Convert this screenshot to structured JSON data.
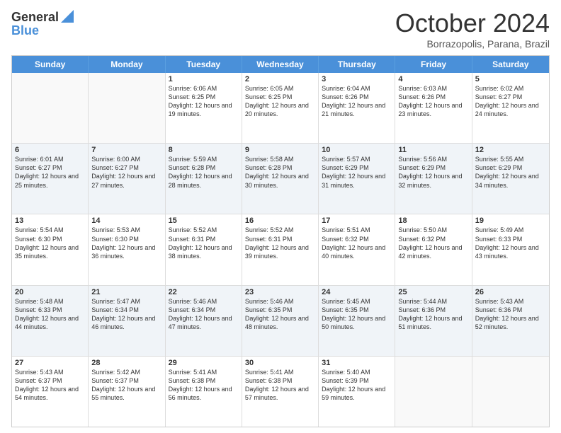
{
  "logo": {
    "line1": "General",
    "line2": "Blue"
  },
  "title": "October 2024",
  "subtitle": "Borrazopolis, Parana, Brazil",
  "days": [
    "Sunday",
    "Monday",
    "Tuesday",
    "Wednesday",
    "Thursday",
    "Friday",
    "Saturday"
  ],
  "rows": [
    [
      {
        "day": "",
        "text": "",
        "empty": true
      },
      {
        "day": "",
        "text": "",
        "empty": true
      },
      {
        "day": "1",
        "text": "Sunrise: 6:06 AM\nSunset: 6:25 PM\nDaylight: 12 hours and 19 minutes."
      },
      {
        "day": "2",
        "text": "Sunrise: 6:05 AM\nSunset: 6:25 PM\nDaylight: 12 hours and 20 minutes."
      },
      {
        "day": "3",
        "text": "Sunrise: 6:04 AM\nSunset: 6:26 PM\nDaylight: 12 hours and 21 minutes."
      },
      {
        "day": "4",
        "text": "Sunrise: 6:03 AM\nSunset: 6:26 PM\nDaylight: 12 hours and 23 minutes."
      },
      {
        "day": "5",
        "text": "Sunrise: 6:02 AM\nSunset: 6:27 PM\nDaylight: 12 hours and 24 minutes."
      }
    ],
    [
      {
        "day": "6",
        "text": "Sunrise: 6:01 AM\nSunset: 6:27 PM\nDaylight: 12 hours and 25 minutes."
      },
      {
        "day": "7",
        "text": "Sunrise: 6:00 AM\nSunset: 6:27 PM\nDaylight: 12 hours and 27 minutes."
      },
      {
        "day": "8",
        "text": "Sunrise: 5:59 AM\nSunset: 6:28 PM\nDaylight: 12 hours and 28 minutes."
      },
      {
        "day": "9",
        "text": "Sunrise: 5:58 AM\nSunset: 6:28 PM\nDaylight: 12 hours and 30 minutes."
      },
      {
        "day": "10",
        "text": "Sunrise: 5:57 AM\nSunset: 6:29 PM\nDaylight: 12 hours and 31 minutes."
      },
      {
        "day": "11",
        "text": "Sunrise: 5:56 AM\nSunset: 6:29 PM\nDaylight: 12 hours and 32 minutes."
      },
      {
        "day": "12",
        "text": "Sunrise: 5:55 AM\nSunset: 6:29 PM\nDaylight: 12 hours and 34 minutes."
      }
    ],
    [
      {
        "day": "13",
        "text": "Sunrise: 5:54 AM\nSunset: 6:30 PM\nDaylight: 12 hours and 35 minutes."
      },
      {
        "day": "14",
        "text": "Sunrise: 5:53 AM\nSunset: 6:30 PM\nDaylight: 12 hours and 36 minutes."
      },
      {
        "day": "15",
        "text": "Sunrise: 5:52 AM\nSunset: 6:31 PM\nDaylight: 12 hours and 38 minutes."
      },
      {
        "day": "16",
        "text": "Sunrise: 5:52 AM\nSunset: 6:31 PM\nDaylight: 12 hours and 39 minutes."
      },
      {
        "day": "17",
        "text": "Sunrise: 5:51 AM\nSunset: 6:32 PM\nDaylight: 12 hours and 40 minutes."
      },
      {
        "day": "18",
        "text": "Sunrise: 5:50 AM\nSunset: 6:32 PM\nDaylight: 12 hours and 42 minutes."
      },
      {
        "day": "19",
        "text": "Sunrise: 5:49 AM\nSunset: 6:33 PM\nDaylight: 12 hours and 43 minutes."
      }
    ],
    [
      {
        "day": "20",
        "text": "Sunrise: 5:48 AM\nSunset: 6:33 PM\nDaylight: 12 hours and 44 minutes."
      },
      {
        "day": "21",
        "text": "Sunrise: 5:47 AM\nSunset: 6:34 PM\nDaylight: 12 hours and 46 minutes."
      },
      {
        "day": "22",
        "text": "Sunrise: 5:46 AM\nSunset: 6:34 PM\nDaylight: 12 hours and 47 minutes."
      },
      {
        "day": "23",
        "text": "Sunrise: 5:46 AM\nSunset: 6:35 PM\nDaylight: 12 hours and 48 minutes."
      },
      {
        "day": "24",
        "text": "Sunrise: 5:45 AM\nSunset: 6:35 PM\nDaylight: 12 hours and 50 minutes."
      },
      {
        "day": "25",
        "text": "Sunrise: 5:44 AM\nSunset: 6:36 PM\nDaylight: 12 hours and 51 minutes."
      },
      {
        "day": "26",
        "text": "Sunrise: 5:43 AM\nSunset: 6:36 PM\nDaylight: 12 hours and 52 minutes."
      }
    ],
    [
      {
        "day": "27",
        "text": "Sunrise: 5:43 AM\nSunset: 6:37 PM\nDaylight: 12 hours and 54 minutes."
      },
      {
        "day": "28",
        "text": "Sunrise: 5:42 AM\nSunset: 6:37 PM\nDaylight: 12 hours and 55 minutes."
      },
      {
        "day": "29",
        "text": "Sunrise: 5:41 AM\nSunset: 6:38 PM\nDaylight: 12 hours and 56 minutes."
      },
      {
        "day": "30",
        "text": "Sunrise: 5:41 AM\nSunset: 6:38 PM\nDaylight: 12 hours and 57 minutes."
      },
      {
        "day": "31",
        "text": "Sunrise: 5:40 AM\nSunset: 6:39 PM\nDaylight: 12 hours and 59 minutes."
      },
      {
        "day": "",
        "text": "",
        "empty": true
      },
      {
        "day": "",
        "text": "",
        "empty": true
      }
    ]
  ]
}
